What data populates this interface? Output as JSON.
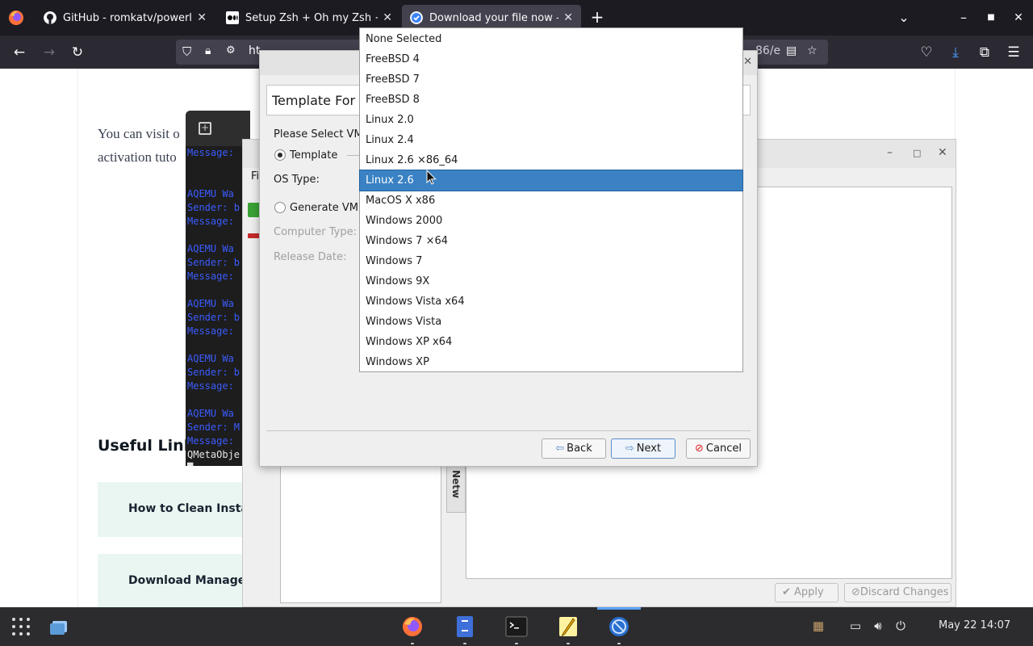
{
  "browser": {
    "tabs": [
      {
        "title": "GitHub - romkatv/powerle",
        "favicon": "github-icon"
      },
      {
        "title": "Setup Zsh + Oh my Zsh +",
        "favicon": "medium-icon"
      },
      {
        "title": "Download your file now - ",
        "favicon": "checkmark-icon",
        "active": true
      }
    ],
    "new_tab": "+",
    "url_prefix": "ht",
    "url_fragment": "86/e"
  },
  "page": {
    "lead_line1": "You can visit o",
    "lead_line2": "activation tuto",
    "useful_links_heading": "Useful Links",
    "link_cards": [
      "How to Clean Install",
      "Download Manager"
    ]
  },
  "terminal": {
    "lines": [
      {
        "text": "Message:",
        "type": "blue"
      },
      {
        "text": "",
        "type": "blue"
      },
      {
        "text": "",
        "type": "blue"
      },
      {
        "text": "AQEMU Wa",
        "type": "blue"
      },
      {
        "text": "Sender: b",
        "type": "blue"
      },
      {
        "text": "Message:",
        "type": "blue"
      },
      {
        "text": "",
        "type": "blue"
      },
      {
        "text": "AQEMU Wa",
        "type": "blue"
      },
      {
        "text": "Sender: b",
        "type": "blue"
      },
      {
        "text": "Message:",
        "type": "blue"
      },
      {
        "text": "",
        "type": "blue"
      },
      {
        "text": "AQEMU Wa",
        "type": "blue"
      },
      {
        "text": "Sender: b",
        "type": "blue"
      },
      {
        "text": "Message:",
        "type": "blue"
      },
      {
        "text": "",
        "type": "blue"
      },
      {
        "text": "AQEMU Wa",
        "type": "blue"
      },
      {
        "text": "Sender: b",
        "type": "blue"
      },
      {
        "text": "Message:",
        "type": "blue"
      },
      {
        "text": "",
        "type": "blue"
      },
      {
        "text": "AQEMU Wa",
        "type": "blue"
      },
      {
        "text": "Sender: M",
        "type": "blue"
      },
      {
        "text": "Message:",
        "type": "blue"
      },
      {
        "text": "QMetaObje",
        "type": "white"
      },
      {
        "text": "█",
        "type": "white"
      }
    ]
  },
  "vm_manager": {
    "menu_first": "Fi",
    "tab_label": "Netw",
    "apply_label": "Apply",
    "discard_label": "Discard Changes"
  },
  "wizard": {
    "header": "Template For V",
    "prompt": "Please Select VM",
    "template_label": "Template",
    "os_type_label": "OS Type:",
    "generate_label": "Generate VM",
    "computer_type_label": "Computer Type:",
    "release_date_label": "Release Date:",
    "back_label": "Back",
    "next_label": "Next",
    "cancel_label": "Cancel"
  },
  "os_dropdown": {
    "options": [
      "None Selected",
      "FreeBSD 4",
      "FreeBSD 7",
      "FreeBSD 8",
      "Linux 2.0",
      "Linux 2.4",
      "Linux 2.6 ×86_64",
      "Linux 2.6",
      "MacOS X x86",
      "Windows 2000",
      "Windows 7 ×64",
      "Windows 7",
      "Windows 9X",
      "Windows Vista x64",
      "Windows Vista",
      "Windows XP x64",
      "Windows XP"
    ],
    "selected_index": 7,
    "highlight_color": "#3a82c4"
  },
  "taskbar": {
    "apps": [
      "firefox-icon",
      "file-manager-icon",
      "terminal-icon",
      "text-editor-icon",
      "vm-manager-icon"
    ],
    "clock": "May 22  14:07"
  }
}
